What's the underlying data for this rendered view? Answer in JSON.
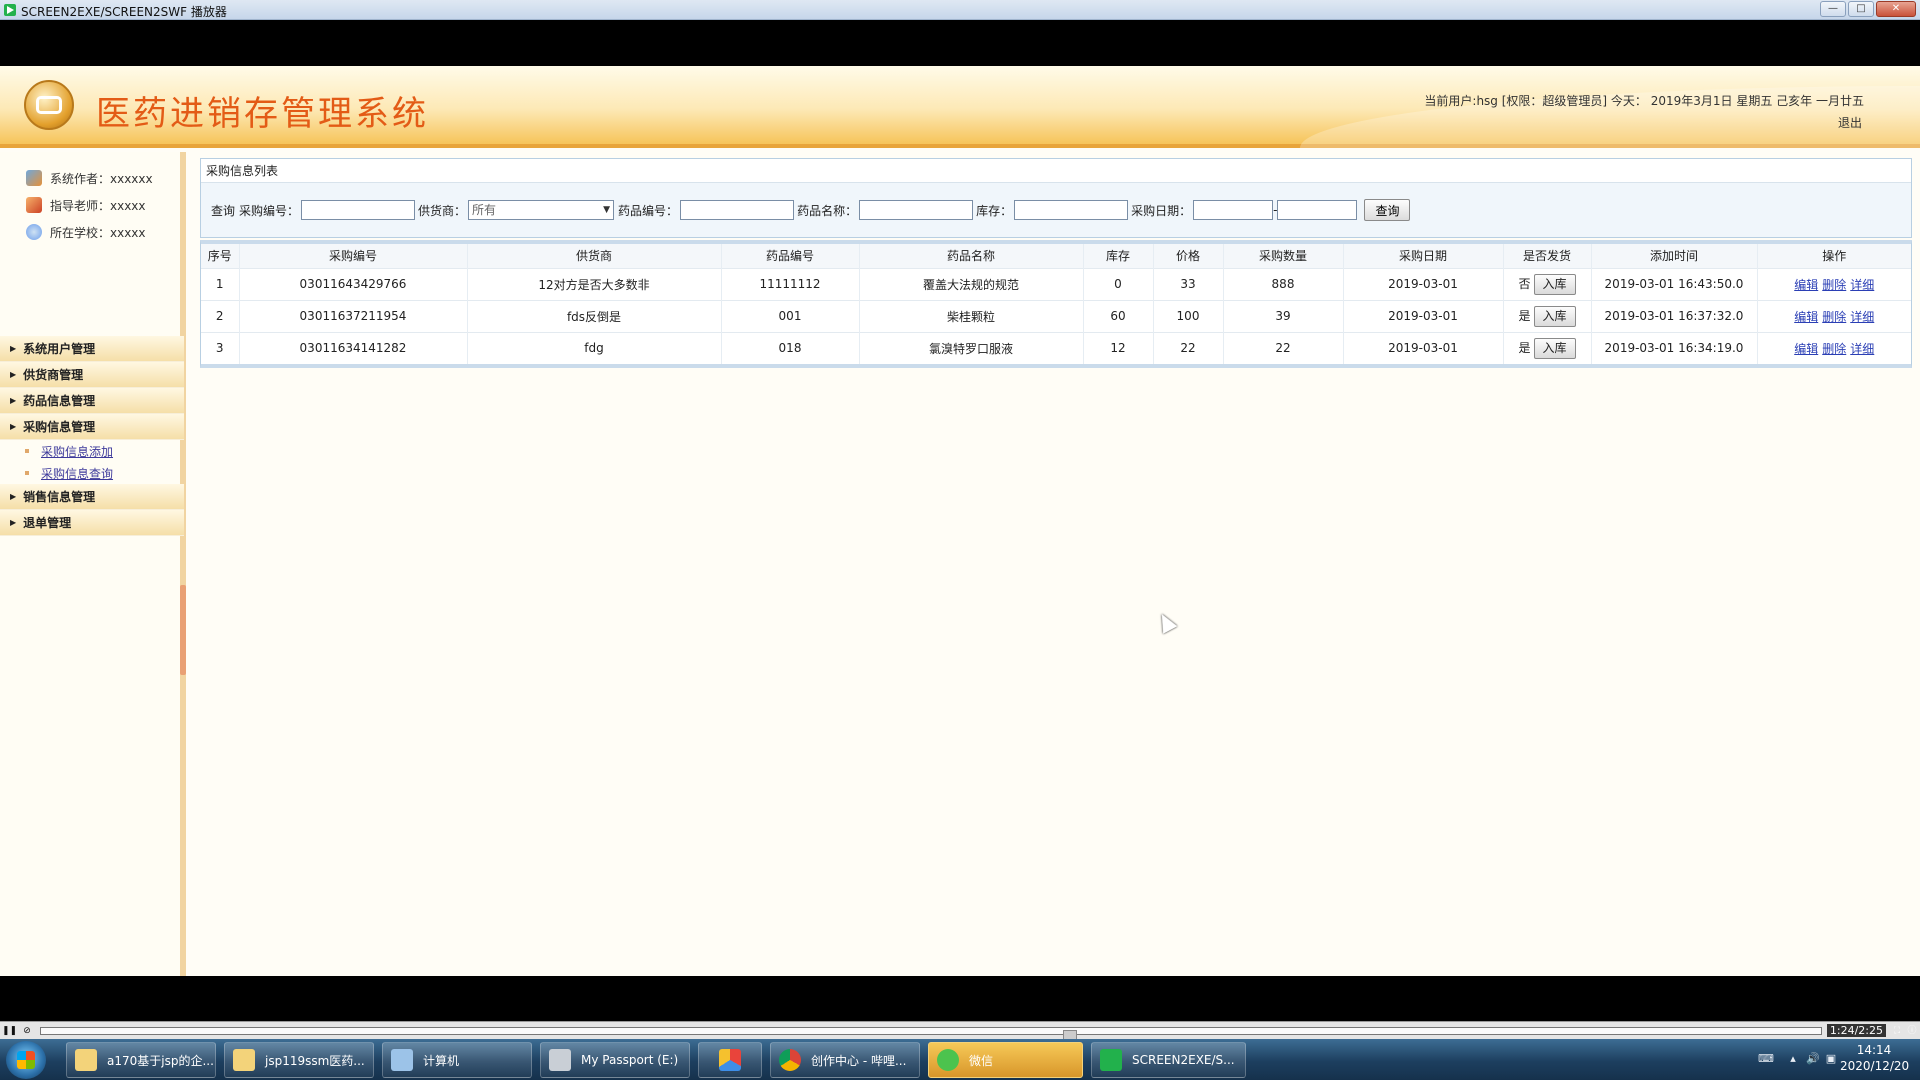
{
  "player": {
    "title": "SCREEN2EXE/SCREEN2SWF 播放器",
    "minimize": "—",
    "maximize": "□",
    "close": "✕",
    "time": "1:24/2:25"
  },
  "header": {
    "site_title": "医药进销存管理系统",
    "user_info": "当前用户:hsg [权限：超级管理员] 今天： 2019年3月1日 星期五 己亥年 一月廿五",
    "logout": "退出"
  },
  "sidebar": {
    "info": [
      {
        "label": "系统作者：xxxxxx",
        "icon": "users-icon"
      },
      {
        "label": "指导老师：xxxxx",
        "icon": "teacher-icon"
      },
      {
        "label": "所在学校：xxxxx",
        "icon": "school-icon"
      }
    ],
    "menu": [
      {
        "label": "系统用户管理"
      },
      {
        "label": "供货商管理"
      },
      {
        "label": "药品信息管理"
      },
      {
        "label": "采购信息管理",
        "sub": [
          {
            "label": "采购信息添加"
          },
          {
            "label": "采购信息查询"
          }
        ]
      },
      {
        "label": "销售信息管理"
      },
      {
        "label": "退单管理"
      }
    ]
  },
  "panel": {
    "title": "采购信息列表"
  },
  "search": {
    "query_label": "查询",
    "purchase_no_label": "采购编号：",
    "supplier_label": "供货商：",
    "supplier_value": "所有",
    "drug_no_label": "药品编号：",
    "drug_name_label": "药品名称：",
    "stock_label": "库存：",
    "date_label": "采购日期：",
    "date_sep": "-",
    "query_button": "查询"
  },
  "table": {
    "headers": [
      "序号",
      "采购编号",
      "供货商",
      "药品编号",
      "药品名称",
      "库存",
      "价格",
      "采购数量",
      "采购日期",
      "是否发货",
      "添加时间",
      "操作"
    ],
    "rows": [
      {
        "idx": "1",
        "purchase_no": "03011643429766",
        "supplier": "12对方是否大多数非",
        "drug_no": "11111112",
        "drug_name": "覆盖大法规的规范",
        "stock": "0",
        "price": "33",
        "qty": "888",
        "date": "2019-03-01",
        "shipped": "否",
        "stock_btn": "入库",
        "added": "2019-03-01 16:43:50.0",
        "edit": "编辑",
        "delete": "删除",
        "detail": "详细"
      },
      {
        "idx": "2",
        "purchase_no": "03011637211954",
        "supplier": "fds反倒是",
        "drug_no": "001",
        "drug_name": "柴桂颗粒",
        "stock": "60",
        "price": "100",
        "qty": "39",
        "date": "2019-03-01",
        "shipped": "是",
        "stock_btn": "入库",
        "added": "2019-03-01 16:37:32.0",
        "edit": "编辑",
        "delete": "删除",
        "detail": "详细"
      },
      {
        "idx": "3",
        "purchase_no": "03011634141282",
        "supplier": "fdg",
        "drug_no": "018",
        "drug_name": "氯溴特罗口服液",
        "stock": "12",
        "price": "22",
        "qty": "22",
        "date": "2019-03-01",
        "shipped": "是",
        "stock_btn": "入库",
        "added": "2019-03-01 16:34:19.0",
        "edit": "编辑",
        "delete": "删除",
        "detail": "详细"
      }
    ]
  },
  "taskbar": {
    "tasks": [
      {
        "label": "a170基于jsp的企...",
        "icon": "folder-icon",
        "color": "#f3d37a"
      },
      {
        "label": "jsp119ssm医药...",
        "icon": "folder-icon",
        "color": "#f3d37a"
      },
      {
        "label": "计算机",
        "icon": "computer-icon",
        "color": "#9cc3e8"
      },
      {
        "label": "My Passport (E:)",
        "icon": "drive-icon",
        "color": "#c9cfd6"
      },
      {
        "label": "",
        "icon": "app-icon",
        "color": "#e9443b"
      },
      {
        "label": "创作中心 - 哔哩...",
        "icon": "chrome-icon",
        "color": "#4aa854"
      },
      {
        "label": "微信",
        "icon": "wechat-icon",
        "color": "#4cc34e"
      },
      {
        "label": "SCREEN2EXE/S...",
        "icon": "screen2exe-icon",
        "color": "#22b14c"
      }
    ],
    "clock_time": "14:14",
    "clock_date": "2020/12/20"
  },
  "colors": {
    "title_orange": "#e35b16",
    "link_blue": "#2b3fb5"
  }
}
